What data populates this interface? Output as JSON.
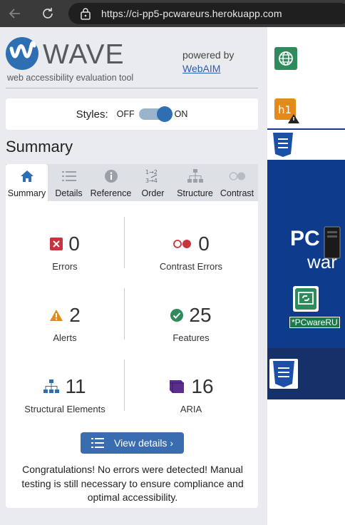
{
  "browser": {
    "url": "https://ci-pp5-pcwareurs.herokuapp.com"
  },
  "wave": {
    "logo_text": "WAVE",
    "logo_subtitle": "web accessibility evaluation tool",
    "powered_by": "powered by",
    "webaim_link": "WebAIM",
    "styles_label": "Styles:",
    "styles_off": "OFF",
    "styles_on": "ON",
    "summary_title": "Summary",
    "tabs": [
      {
        "label": "Summary",
        "icon": "home-icon"
      },
      {
        "label": "Details",
        "icon": "list-icon"
      },
      {
        "label": "Reference",
        "icon": "info-icon"
      },
      {
        "label": "Order",
        "icon": "order-icon"
      },
      {
        "label": "Structure",
        "icon": "structure-icon"
      },
      {
        "label": "Contrast",
        "icon": "contrast-icon"
      }
    ],
    "stats": {
      "errors": {
        "value": "0",
        "label": "Errors"
      },
      "contrast_errors": {
        "value": "0",
        "label": "Contrast Errors"
      },
      "alerts": {
        "value": "2",
        "label": "Alerts"
      },
      "features": {
        "value": "25",
        "label": "Features"
      },
      "structural": {
        "value": "11",
        "label": "Structural Elements"
      },
      "aria": {
        "value": "16",
        "label": "ARIA"
      }
    },
    "view_details": "View details ›",
    "congrats": "Congratulations! No errors were detected! Manual testing is still necessary to ensure compliance and optimal accessibility."
  },
  "page_preview": {
    "pc_text": "PC",
    "ware_text": "war",
    "green_label": "*PCwareRU",
    "h1_label": "h1"
  },
  "colors": {
    "wave_blue": "#2e6fb4",
    "error_red": "#c8343b",
    "alert_orange": "#e38a1b",
    "feature_green": "#2f8a5c",
    "aria_purple": "#5b2d8e"
  }
}
